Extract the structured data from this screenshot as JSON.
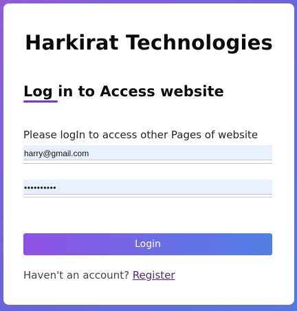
{
  "brand": {
    "title": "Harkirat Technologies"
  },
  "login": {
    "heading": "Log in to Access website",
    "info": "Please logIn to access other Pages of website",
    "email_value": "harry@gmail.com",
    "password_value": "harrybhaid",
    "button_label": "Login"
  },
  "footer": {
    "prompt": "Haven't an account? ",
    "register_link": "Register"
  },
  "colors": {
    "accent_purple": "#7a2fe0",
    "button_start": "#9152e6",
    "button_end": "#4f80e4",
    "input_bg": "#e8f0fd"
  }
}
